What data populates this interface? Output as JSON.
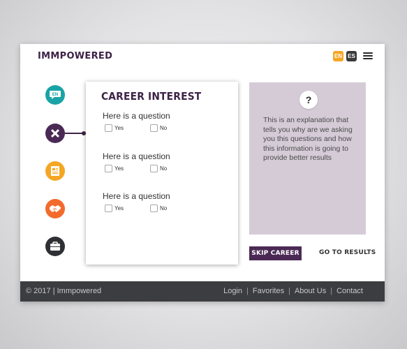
{
  "header": {
    "logo": "IMMPOWERED",
    "languages": [
      {
        "code": "EN",
        "active": true,
        "color": "#f5a623"
      },
      {
        "code": "ES",
        "active": false,
        "color": "#3a3a3a"
      }
    ],
    "menu_icon": "hamburger-icon"
  },
  "sidebar": {
    "items": [
      {
        "icon": "speech-bubble-icon",
        "label": "EN",
        "color": "#1aa3a6"
      },
      {
        "icon": "pencil-ruler-icon",
        "color": "#4a2a55",
        "active": true
      },
      {
        "icon": "document-icon",
        "color": "#f5a623"
      },
      {
        "icon": "handshake-icon",
        "color": "#f26b2d"
      },
      {
        "icon": "briefcase-icon",
        "color": "#2f3033"
      }
    ]
  },
  "card": {
    "title": "CAREER INTEREST",
    "questions": [
      {
        "text": "Here is a question",
        "yes": "Yes",
        "no": "No"
      },
      {
        "text": "Here is a question",
        "yes": "Yes",
        "no": "No"
      },
      {
        "text": "Here is a question",
        "yes": "Yes",
        "no": "No"
      }
    ]
  },
  "info": {
    "icon_label": "?",
    "text": "This is an explanation that tells you why are we asking you this questions and how this information is going to provide better results",
    "background": "#d5cbd7"
  },
  "actions": {
    "skip": "SKIP CAREER",
    "results": "GO TO RESULTS"
  },
  "footer": {
    "copyright": "© 2017 | Immpowered",
    "links": [
      "Login",
      "Favorites",
      "About Us",
      "Contact"
    ]
  },
  "colors": {
    "brand": "#3e2347",
    "accent_orange": "#f5a623",
    "footer_bg": "#3c3d40"
  }
}
